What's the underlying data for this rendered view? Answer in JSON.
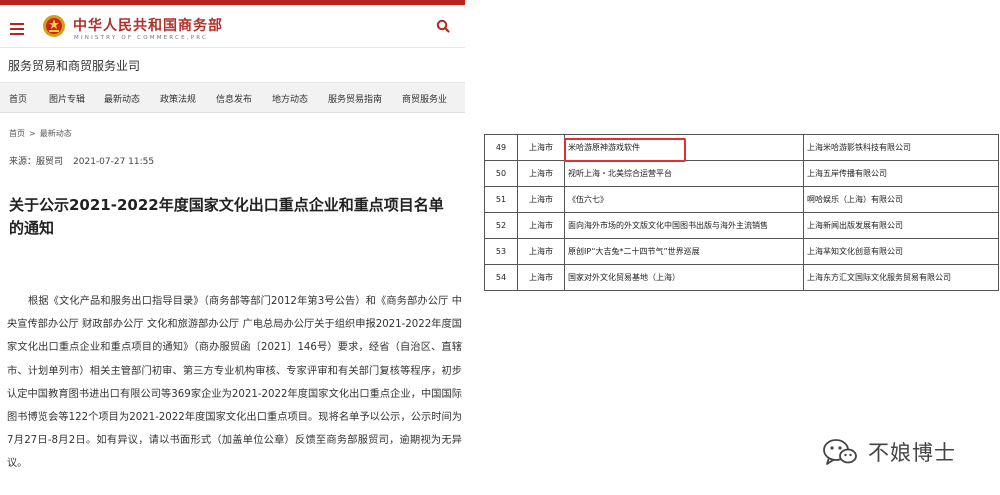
{
  "site": {
    "title_cn": "中华人民共和国商务部",
    "title_en": "MINISTRY OF COMMERCE,PRC",
    "department": "服务贸易和商贸服务业司",
    "brand_color": "#b8251d"
  },
  "nav": {
    "items": [
      "首页",
      "图片专辑",
      "最新动态",
      "政策法规",
      "信息发布",
      "地方动态",
      "服务贸易指南",
      "商贸服务业"
    ]
  },
  "breadcrumb": {
    "home": "首页",
    "separator": ">",
    "current": "最新动态"
  },
  "meta": {
    "source": "来源：服贸司",
    "datetime": "2021-07-27 11:55"
  },
  "article": {
    "title": "关于公示2021-2022年度国家文化出口重点企业和重点项目名单的通知",
    "body": "根据《文化产品和服务出口指导目录》（商务部等部门2012年第3号公告）和《商务部办公厅 中央宣传部办公厅 财政部办公厅 文化和旅游部办公厅 广电总局办公厅关于组织申报2021-2022年度国家文化出口重点企业和重点项目的通知》（商办服贸函〔2021〕146号）要求，经省（自治区、直辖市、计划单列市）相关主管部门初审、第三方专业机构审核、专家评审和有关部门复核等程序，初步认定中国教育图书进出口有限公司等369家企业为2021-2022年度国家文化出口重点企业，中国国际图书博览会等122个项目为2021-2022年度国家文化出口重点项目。现将名单予以公示，公示时间为7月27日-8月2日。如有异议，请以书面形式（加盖单位公章）反馈至商务部服贸司，逾期视为无异议。"
  },
  "table": {
    "rows": [
      {
        "no": "49",
        "city": "上海市",
        "project": "米哈游原神游戏软件",
        "company": "上海米哈游影铁科技有限公司"
      },
      {
        "no": "50",
        "city": "上海市",
        "project": "视听上海・北美综合运营平台",
        "company": "上海五岸传播有限公司"
      },
      {
        "no": "51",
        "city": "上海市",
        "project": "《伍六七》",
        "company": "啊哈娱乐（上海）有限公司"
      },
      {
        "no": "52",
        "city": "上海市",
        "project": "面向海外市场的外文版文化中国图书出版与海外主流销售",
        "company": "上海新闻出版发展有限公司"
      },
      {
        "no": "53",
        "city": "上海市",
        "project": "原创IP“大吉兔*二十四节气”世界巡展",
        "company": "上海芈知文化创意有限公司"
      },
      {
        "no": "54",
        "city": "上海市",
        "project": "国家对外文化贸易基地（上海）",
        "company": "上海东方汇文国际文化服务贸易有限公司"
      }
    ],
    "highlight_color": "#e03030"
  },
  "watermark": {
    "text": "不娘博士",
    "icon": "wechat-icon"
  }
}
